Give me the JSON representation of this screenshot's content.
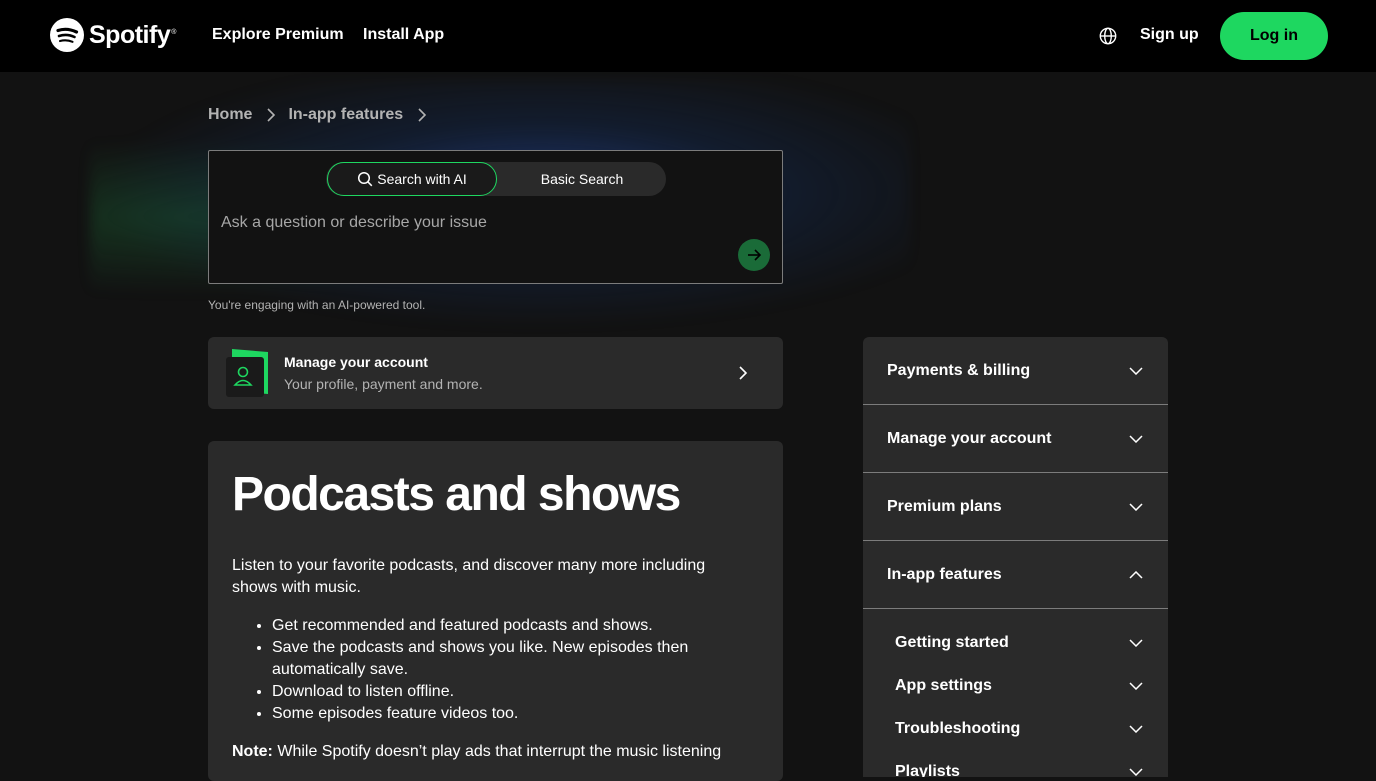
{
  "header": {
    "logo_text": "Spotify",
    "logo_reg": "®",
    "nav": [
      "Explore Premium",
      "Install App"
    ],
    "signup_label": "Sign up",
    "login_label": "Log in"
  },
  "breadcrumb": {
    "items": [
      "Home",
      "In-app features"
    ]
  },
  "search": {
    "mode_ai_label": "Search with AI",
    "mode_basic_label": "Basic Search",
    "placeholder": "Ask a question or describe your issue",
    "ai_note": "You're engaging with an AI-powered tool."
  },
  "manage_card": {
    "title": "Manage your account",
    "subtitle": "Your profile, payment and more."
  },
  "article": {
    "title": "Podcasts and shows",
    "intro": "Listen to your favorite podcasts, and discover many more including shows with music.",
    "bullets": [
      "Get recommended and featured podcasts and shows.",
      "Save the podcasts and shows you like. New episodes then automatically save.",
      "Download to listen offline.",
      "Some episodes feature videos too."
    ],
    "note_label": "Note:",
    "note_text": " While Spotify doesn’t play ads that interrupt the music listening"
  },
  "sidebar": {
    "sections": [
      {
        "label": "Payments & billing",
        "expanded": false
      },
      {
        "label": "Manage your account",
        "expanded": false
      },
      {
        "label": "Premium plans",
        "expanded": false
      },
      {
        "label": "In-app features",
        "expanded": true
      }
    ],
    "subsections": [
      "Getting started",
      "App settings",
      "Troubleshooting",
      "Playlists"
    ]
  },
  "colors": {
    "brand_green": "#1ed760",
    "background": "#121212",
    "card": "#2a2a2a",
    "topbar": "#000000"
  },
  "icons": [
    "spotify-logo-icon",
    "globe-icon",
    "chevron-right-icon",
    "search-icon",
    "arrow-right-icon",
    "user-icon",
    "chevron-down-icon",
    "chevron-up-icon"
  ]
}
